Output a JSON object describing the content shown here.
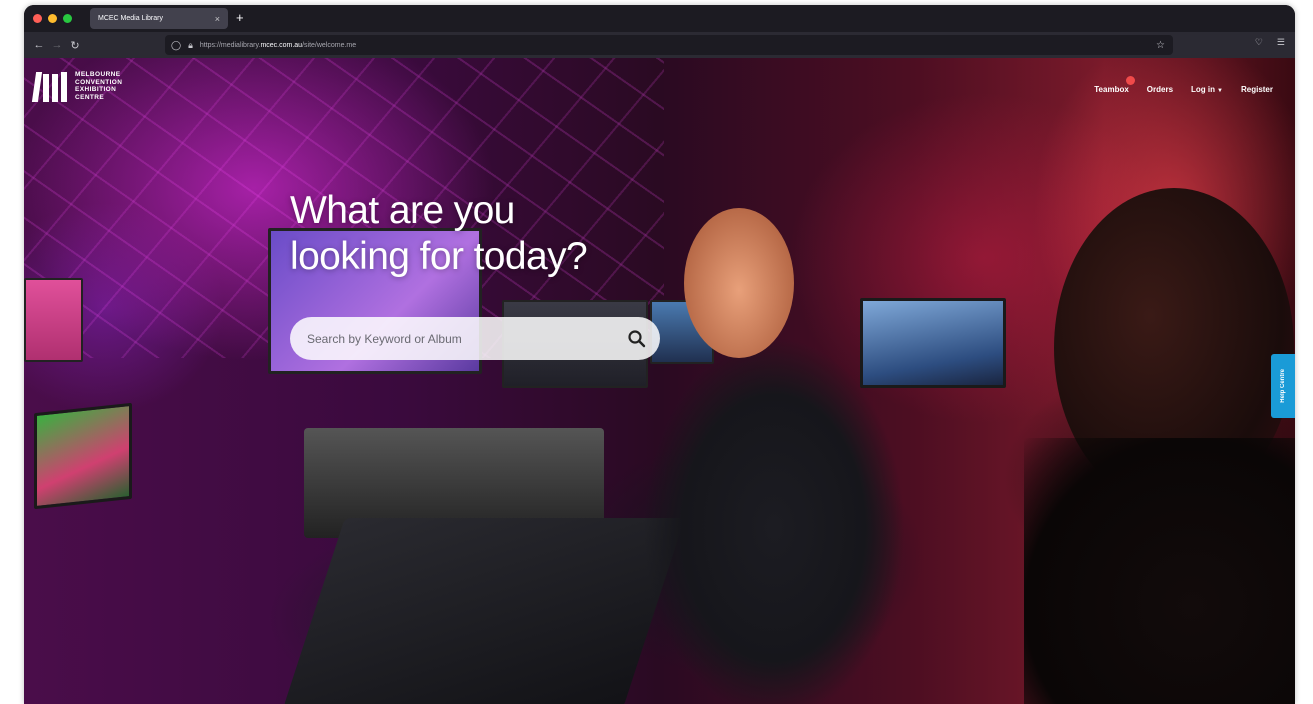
{
  "browser": {
    "tab_title": "MCEC Media Library",
    "tab_close": "×",
    "new_tab": "+",
    "url_prefix": "https://medialibrary.",
    "url_domain": "mcec.com.au",
    "url_path": "/site/welcome.me"
  },
  "site": {
    "logo_lines": [
      "MELBOURNE",
      "CONVENTION",
      "EXHIBITION",
      "CENTRE"
    ],
    "nav": {
      "teambox": "Teambox",
      "orders": "Orders",
      "login": "Log in",
      "register": "Register"
    }
  },
  "hero": {
    "title_line1": "What are you",
    "title_line2": "looking for today?",
    "search_placeholder": "Search by Keyword or Album"
  },
  "help": {
    "label": "Help Centre"
  },
  "colors": {
    "help_tab": "#1a9bd7",
    "notification_badge": "#f04a4a"
  }
}
